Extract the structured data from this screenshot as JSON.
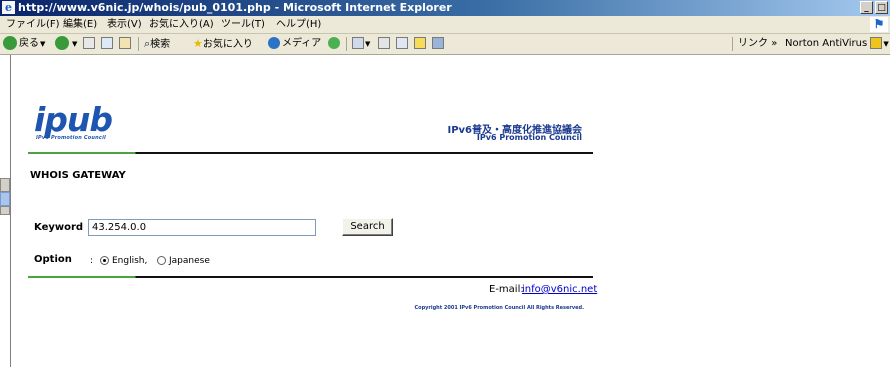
{
  "window": {
    "title": "http://www.v6nic.jp/whois/pub_0101.php - Microsoft Internet Explorer",
    "min_label": "_",
    "max_label": "□",
    "close_label": "X"
  },
  "menubar": {
    "items": [
      "ファイル(F)",
      "編集(E)",
      "表示(V)",
      "お気に入り(A)",
      "ツール(T)",
      "ヘルプ(H)"
    ]
  },
  "toolbar": {
    "back": "戻る",
    "search": "検索",
    "favorites": "お気に入り",
    "media": "メディア",
    "links": "リンク",
    "chevron": "»",
    "norton": "Norton AntiVirus"
  },
  "page": {
    "logo_text": "ipub",
    "logo_subtitle": "IPv6 Promotion Council",
    "org_name_ja": "IPv6普及・高度化推進協議会",
    "org_name_en": "IPv6 Promotion Council",
    "section_title": "WHOIS GATEWAY",
    "keyword_label": "Keyword",
    "keyword_value": "43.254.0.0",
    "search_button": "Search",
    "option_label": "Option",
    "option_colon": ":",
    "option_english": "English,",
    "option_japanese": "Japanese",
    "selected_option": "English",
    "email_label": "E-mail:",
    "email_link": "info@v6nic.net",
    "copyright": "Copyright 2001 IPv6 Promotion Council All Rights Reserved."
  },
  "colors": {
    "accent_green": "#4da33f",
    "brand_blue": "#1d55b0",
    "link_blue": "#0000cc"
  }
}
